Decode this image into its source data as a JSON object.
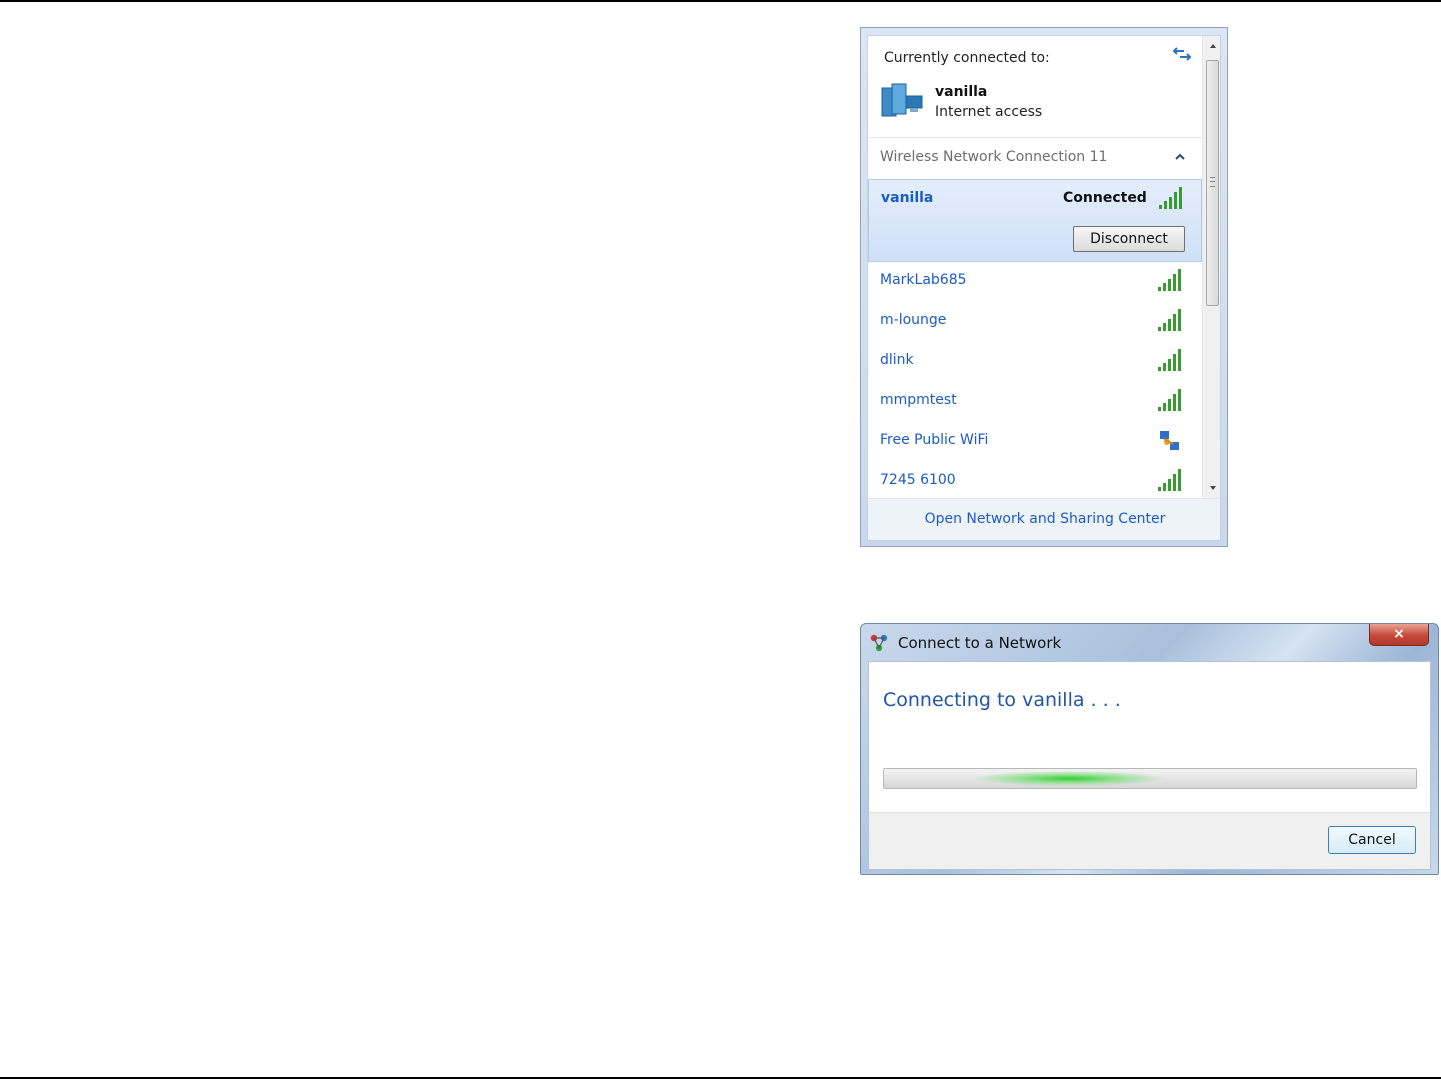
{
  "network_flyout": {
    "currently_connected_label": "Currently connected to:",
    "current_network": {
      "name": "vanilla",
      "status": "Internet access"
    },
    "adapter_label": "Wireless Network Connection 11",
    "selected_network": {
      "name": "vanilla",
      "status": "Connected",
      "signal_bars": 5,
      "disconnect_label": "Disconnect"
    },
    "networks": [
      {
        "name": "MarkLab685",
        "signal": "bars",
        "signal_bars": 5
      },
      {
        "name": "m-lounge",
        "signal": "bars",
        "signal_bars": 5
      },
      {
        "name": "dlink",
        "signal": "bars",
        "signal_bars": 5
      },
      {
        "name": "mmpmtest",
        "signal": "bars",
        "signal_bars": 5
      },
      {
        "name": "Free Public WiFi",
        "signal": "ad-hoc-icon"
      },
      {
        "name": "7245 6100",
        "signal": "bars",
        "signal_bars": 5
      }
    ],
    "footer_link": "Open Network and Sharing Center",
    "icons": [
      "refresh-icon",
      "network-computer-icon",
      "collapse-up-icon",
      "signal-bars-icon",
      "ad-hoc-network-icon",
      "scroll-up-icon",
      "scroll-down-icon"
    ]
  },
  "connect_dialog": {
    "title": "Connect to a Network",
    "close_label": "×",
    "message": "Connecting to vanilla . . .",
    "cancel_label": "Cancel",
    "progress": "indeterminate",
    "colors": {
      "message": "#1f54a6",
      "progress_glow": "#28cd28"
    }
  },
  "colors": {
    "link": "#1a5bc4",
    "selection": "#cfe0f7"
  }
}
